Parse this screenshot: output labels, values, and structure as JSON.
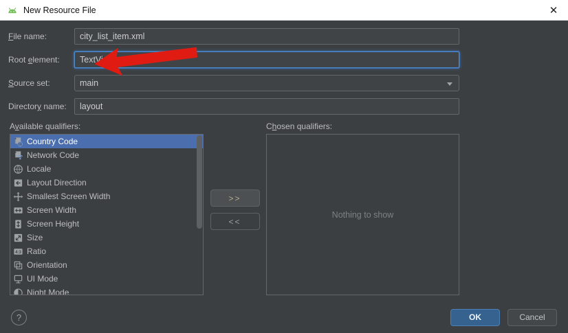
{
  "window": {
    "title": "New Resource File",
    "app_icon": "android-icon",
    "close_icon": "✕"
  },
  "form": {
    "fields": [
      {
        "id": "file-name",
        "label": "File name:",
        "mnemonic_index": 0,
        "type": "text",
        "value": "city_list_item.xml",
        "focused": false
      },
      {
        "id": "root-element",
        "label": "Root element:",
        "mnemonic_index": 5,
        "type": "text",
        "value": "TextView",
        "focused": true
      },
      {
        "id": "source-set",
        "label": "Source set:",
        "mnemonic_index": 0,
        "type": "combo",
        "value": "main",
        "focused": false
      },
      {
        "id": "directory-name",
        "label": "Directory name:",
        "mnemonic_index": 8,
        "type": "text",
        "value": "layout",
        "focused": false
      }
    ]
  },
  "qualifiers": {
    "available_label": "Available qualifiers:",
    "available_mnemonic_index": 1,
    "chosen_label": "Chosen qualifiers:",
    "chosen_mnemonic_index": 1,
    "selected_index": 0,
    "chosen_empty_text": "Nothing to show",
    "add_button_label": ">>",
    "remove_button_label": "<<",
    "available": [
      {
        "label": "Country Code",
        "icon": "flag-globe-icon"
      },
      {
        "label": "Network Code",
        "icon": "flag-signal-icon"
      },
      {
        "label": "Locale",
        "icon": "globe-icon"
      },
      {
        "label": "Layout Direction",
        "icon": "arrow-left-square-icon"
      },
      {
        "label": "Smallest Screen Width",
        "icon": "arrows-out-icon"
      },
      {
        "label": "Screen Width",
        "icon": "arrows-horizontal-icon"
      },
      {
        "label": "Screen Height",
        "icon": "arrows-vertical-icon"
      },
      {
        "label": "Size",
        "icon": "arrows-diagonal-icon"
      },
      {
        "label": "Ratio",
        "icon": "ratio-icon"
      },
      {
        "label": "Orientation",
        "icon": "orientation-icon"
      },
      {
        "label": "UI Mode",
        "icon": "monitor-icon"
      },
      {
        "label": "Night Mode",
        "icon": "half-moon-icon"
      }
    ]
  },
  "footer": {
    "help_label": "?",
    "ok_label": "OK",
    "cancel_label": "Cancel"
  },
  "annotation": {
    "type": "red-arrow",
    "points_at": "root-element-input",
    "color": "#e01b12"
  },
  "colors": {
    "selection": "#4b6eaf",
    "focus_border": "#4a88c7",
    "ok_button": "#35628f",
    "dialog_background": "#3c3f41",
    "titlebar_background": "#ffffff"
  }
}
